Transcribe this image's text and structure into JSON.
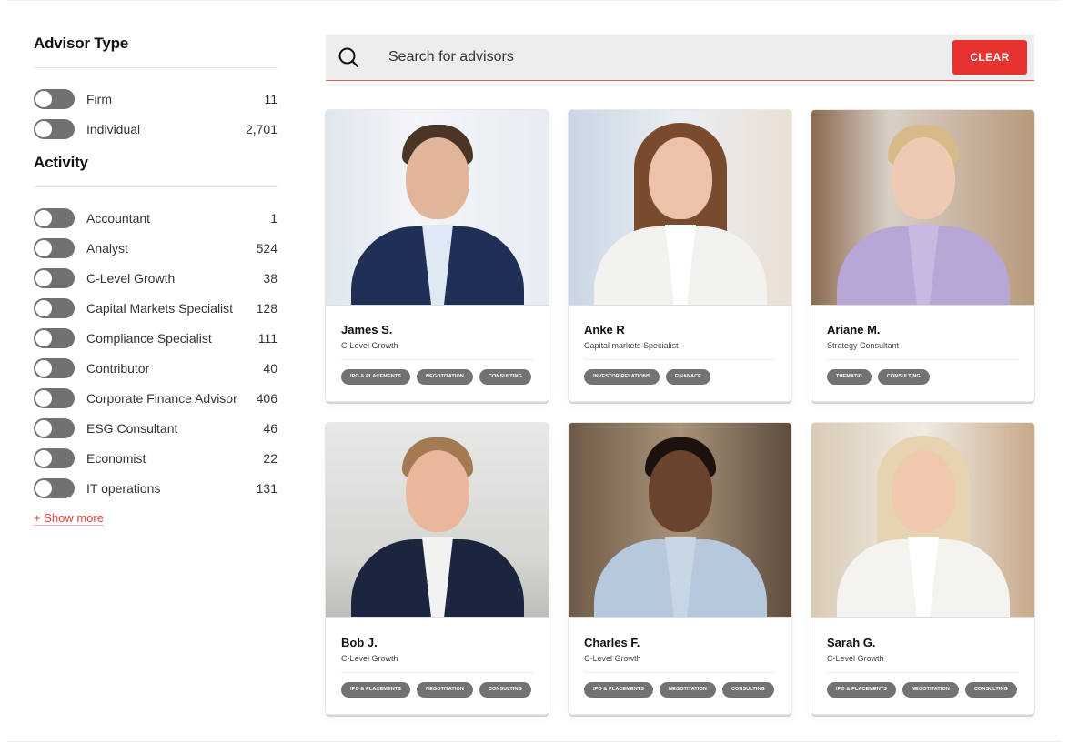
{
  "colors": {
    "accent": "#e8322f",
    "toggle_off": "#717171",
    "tag_bg": "#727272",
    "search_bg": "#ededed"
  },
  "sidebar": {
    "advisor_type": {
      "title": "Advisor Type",
      "items": [
        {
          "label": "Firm",
          "count": "11",
          "enabled": false
        },
        {
          "label": "Individual",
          "count": "2,701",
          "enabled": false
        }
      ]
    },
    "activity": {
      "title": "Activity",
      "items": [
        {
          "label": "Accountant",
          "count": "1",
          "enabled": false
        },
        {
          "label": "Analyst",
          "count": "524",
          "enabled": false
        },
        {
          "label": "C-Level Growth",
          "count": "38",
          "enabled": false
        },
        {
          "label": "Capital Markets Specialist",
          "count": "128",
          "enabled": false
        },
        {
          "label": "Compliance Specialist",
          "count": "111",
          "enabled": false
        },
        {
          "label": "Contributor",
          "count": "40",
          "enabled": false
        },
        {
          "label": "Corporate Finance Advisor",
          "count": "406",
          "enabled": false
        },
        {
          "label": "ESG Consultant",
          "count": "46",
          "enabled": false
        },
        {
          "label": "Economist",
          "count": "22",
          "enabled": false
        },
        {
          "label": "IT operations",
          "count": "131",
          "enabled": false
        }
      ]
    },
    "show_more": "+ Show more"
  },
  "search": {
    "icon": "search-icon",
    "value": "",
    "placeholder": "Search for advisors",
    "clear_label": "CLEAR"
  },
  "advisors": [
    {
      "name": "James S.",
      "role": "C-Level Growth",
      "tags": [
        "IPO & PLACEMENTS",
        "NEGOTITATION",
        "CONSULTING"
      ]
    },
    {
      "name": "Anke R",
      "role": "Capital markets Specialist",
      "tags": [
        "INVESTOR RELATIONS",
        "FINANACE"
      ]
    },
    {
      "name": "Ariane M.",
      "role": "Strategy Consultant",
      "tags": [
        "THEMATIC",
        "CONSULTING"
      ]
    },
    {
      "name": "Bob J.",
      "role": "C-Level Growth",
      "tags": [
        "IPO & PLACEMENTS",
        "NEGOTITATION",
        "CONSULTING"
      ]
    },
    {
      "name": "Charles F.",
      "role": "C-Level Growth",
      "tags": [
        "IPO & PLACEMENTS",
        "NEGOTITATION",
        "CONSULTING"
      ]
    },
    {
      "name": "Sarah G.",
      "role": "C-Level Growth",
      "tags": [
        "IPO & PLACEMENTS",
        "NEGOTITATION",
        "CONSULTING"
      ]
    }
  ]
}
